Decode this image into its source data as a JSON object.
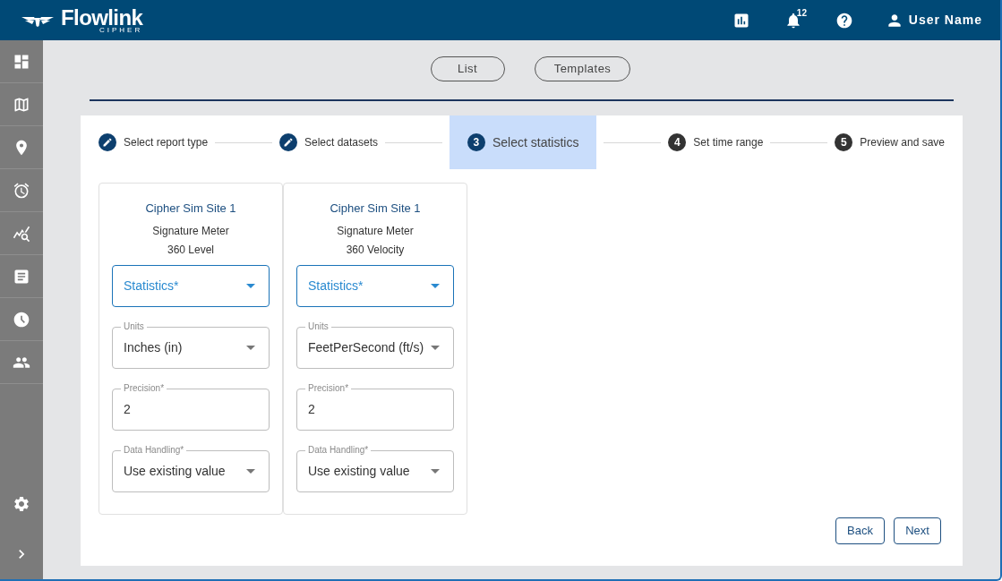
{
  "header": {
    "logo_text": "Flowlink",
    "logo_subtext": "CIPHER",
    "notification_count": "12",
    "user_name": "User Name"
  },
  "view_tabs": [
    {
      "label": "List"
    },
    {
      "label": "Templates"
    }
  ],
  "steps": [
    {
      "label": "Select report type",
      "completed": true,
      "selected": false
    },
    {
      "label": "Select datasets",
      "completed": true,
      "selected": false
    },
    {
      "number": "3",
      "label": "Select statistics",
      "completed": false,
      "selected": true
    },
    {
      "number": "4",
      "label": "Set time range",
      "completed": false,
      "selected": false
    },
    {
      "number": "5",
      "label": "Preview and save",
      "completed": false,
      "selected": false
    }
  ],
  "cards": [
    {
      "site": "Cipher Sim Site 1",
      "meter": "Signature Meter",
      "channel": "360 Level",
      "fields": [
        {
          "kind": "select",
          "placeholder": "Statistics*",
          "focused": true
        },
        {
          "kind": "select",
          "label": "Units",
          "value": "Inches (in)",
          "focused": false
        },
        {
          "kind": "input",
          "label": "Precision*",
          "value": "2",
          "focused": false
        },
        {
          "kind": "select",
          "label": "Data Handling*",
          "value": "Use existing value",
          "focused": false
        }
      ]
    },
    {
      "site": "Cipher Sim Site 1",
      "meter": "Signature Meter",
      "channel": "360 Velocity",
      "fields": [
        {
          "kind": "select",
          "placeholder": "Statistics*",
          "focused": true
        },
        {
          "kind": "select",
          "label": "Units",
          "value": "FeetPerSecond (ft/s)",
          "focused": false
        },
        {
          "kind": "input",
          "label": "Precision*",
          "value": "2",
          "focused": false
        },
        {
          "kind": "select",
          "label": "Data Handling*",
          "value": "Use existing value",
          "focused": false
        }
      ]
    }
  ],
  "actions": [
    {
      "label": "Back"
    },
    {
      "label": "Next"
    }
  ]
}
